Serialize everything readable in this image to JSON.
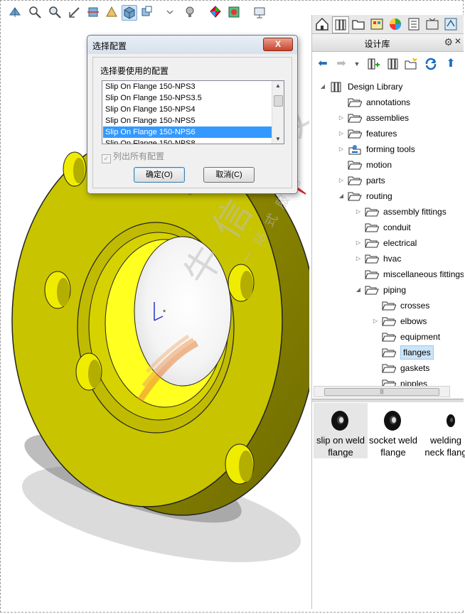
{
  "toolbar": {
    "icons": [
      "view-orientation-icon",
      "zoom-to-fit-icon",
      "zoom-area-icon",
      "previous-view-icon",
      "section-view-icon",
      "dynamic-annotation-icon",
      "display-style-icon",
      "hide-show-items-icon",
      "edit-appearance-icon",
      "apply-scene-icon",
      "view-settings-icon"
    ]
  },
  "dialog": {
    "title": "选择配置",
    "close_label": "X",
    "prompt": "选择要使用的配置",
    "configurations": [
      "Slip On Flange 150-NPS3",
      "Slip On Flange 150-NPS3.5",
      "Slip On Flange 150-NPS4",
      "Slip On Flange 150-NPS5",
      "Slip On Flange 150-NPS6",
      "Slip On Flange 150-NPS8"
    ],
    "selected_index": 4,
    "list_all_label": "列出所有配置",
    "list_all_checked": true,
    "ok_label": "确定(O)",
    "cancel_label": "取消(C)"
  },
  "watermark": {
    "main": "牛 信 科 技",
    "sub": "一 站 式 服 务"
  },
  "taskpane": {
    "title": "设计库",
    "tabs": [
      "home-icon",
      "design-library-tab-icon",
      "file-explorer-icon",
      "view-palette-icon",
      "appearances-icon",
      "custom-properties-icon",
      "solidworks-forum-icon",
      "toolbox-icon"
    ],
    "tree": [
      {
        "label": "Design Library",
        "level": 0,
        "expander": "open",
        "root": true
      },
      {
        "label": "annotations",
        "level": 1,
        "expander": "none"
      },
      {
        "label": "assemblies",
        "level": 1,
        "expander": "closed"
      },
      {
        "label": "features",
        "level": 1,
        "expander": "closed"
      },
      {
        "label": "forming tools",
        "level": 1,
        "expander": "closed",
        "special": true
      },
      {
        "label": "motion",
        "level": 1,
        "expander": "none"
      },
      {
        "label": "parts",
        "level": 1,
        "expander": "closed"
      },
      {
        "label": "routing",
        "level": 1,
        "expander": "open"
      },
      {
        "label": "assembly fittings",
        "level": 2,
        "expander": "closed"
      },
      {
        "label": "conduit",
        "level": 2,
        "expander": "none"
      },
      {
        "label": "electrical",
        "level": 2,
        "expander": "closed"
      },
      {
        "label": "hvac",
        "level": 2,
        "expander": "closed"
      },
      {
        "label": "miscellaneous fittings",
        "level": 2,
        "expander": "none"
      },
      {
        "label": "piping",
        "level": 2,
        "expander": "open"
      },
      {
        "label": "crosses",
        "level": 3,
        "expander": "none"
      },
      {
        "label": "elbows",
        "level": 3,
        "expander": "closed"
      },
      {
        "label": "equipment",
        "level": 3,
        "expander": "none"
      },
      {
        "label": "flanges",
        "level": 3,
        "expander": "none",
        "selected": true
      },
      {
        "label": "gaskets",
        "level": 3,
        "expander": "none"
      },
      {
        "label": "nipples",
        "level": 3,
        "expander": "none"
      }
    ],
    "gallery": [
      {
        "line1": "slip on weld",
        "line2": "flange",
        "selected": true
      },
      {
        "line1": "socket weld",
        "line2": "flange",
        "selected": false
      },
      {
        "line1": "welding",
        "line2": "neck flang",
        "selected": false
      }
    ]
  },
  "colors": {
    "flange": "#c8c400",
    "flange_dark": "#8f8a00",
    "selection": "#3399ff",
    "arrow": "#d9262b"
  }
}
